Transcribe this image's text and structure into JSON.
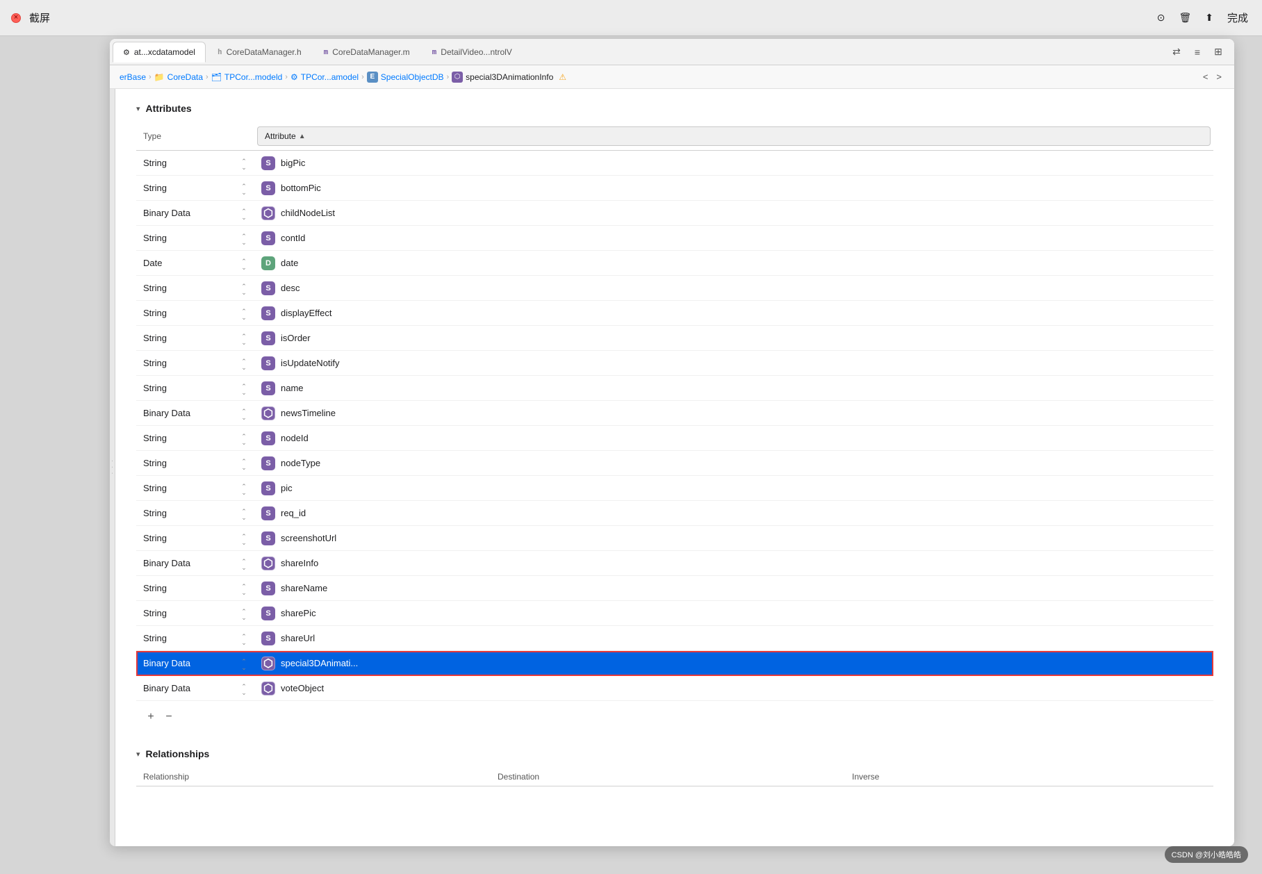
{
  "titleBar": {
    "title": "截屏",
    "closeLabel": "×",
    "actions": {
      "person": "⊙",
      "trash": "🗑",
      "share": "⬆",
      "done": "完成"
    }
  },
  "tabs": [
    {
      "id": "xcdatamodel",
      "label": "at...xcdatamodel",
      "icon": "",
      "active": true
    },
    {
      "id": "coredatamanager-h",
      "label": "CoreDataManager.h",
      "icon": "h",
      "active": false
    },
    {
      "id": "coredatamanager-m",
      "label": "CoreDataManager.m",
      "icon": "m",
      "active": false
    },
    {
      "id": "detailvideo-m",
      "label": "DetailVideo...ntrolV",
      "icon": "m",
      "active": false
    }
  ],
  "tabBarActions": {
    "swap": "⇄",
    "lines": "≡",
    "plus": "⊞"
  },
  "breadcrumb": {
    "items": [
      {
        "label": "erBase",
        "icon": "",
        "type": "folder"
      },
      {
        "label": "CoreData",
        "icon": "📁",
        "type": "folder"
      },
      {
        "label": "TPCor...modeld",
        "icon": "🗂",
        "type": "group"
      },
      {
        "label": "TPCor...amodel",
        "icon": "⚙",
        "type": "model"
      },
      {
        "label": "SpecialObjectDB",
        "icon": "E",
        "type": "entity"
      },
      {
        "label": "special3DAnimationInfo",
        "icon": "⬡",
        "type": "attribute"
      }
    ],
    "warning": "⚠",
    "navBack": "<",
    "navForward": ">"
  },
  "sections": {
    "attributes": {
      "title": "Attributes",
      "collapsed": false,
      "tableHeaders": {
        "type": "Type",
        "attribute": "Attribute",
        "sortAsc": true
      },
      "rows": [
        {
          "type": "String",
          "badge": "S",
          "badgeType": "s",
          "name": "bigPic"
        },
        {
          "type": "String",
          "badge": "S",
          "badgeType": "s",
          "name": "bottomPic"
        },
        {
          "type": "Binary Data",
          "badge": "⬡",
          "badgeType": "binary",
          "name": "childNodeList"
        },
        {
          "type": "String",
          "badge": "S",
          "badgeType": "s",
          "name": "contId"
        },
        {
          "type": "Date",
          "badge": "D",
          "badgeType": "d",
          "name": "date"
        },
        {
          "type": "String",
          "badge": "S",
          "badgeType": "s",
          "name": "desc"
        },
        {
          "type": "String",
          "badge": "S",
          "badgeType": "s",
          "name": "displayEffect"
        },
        {
          "type": "String",
          "badge": "S",
          "badgeType": "s",
          "name": "isOrder"
        },
        {
          "type": "String",
          "badge": "S",
          "badgeType": "s",
          "name": "isUpdateNotify"
        },
        {
          "type": "String",
          "badge": "S",
          "badgeType": "s",
          "name": "name"
        },
        {
          "type": "Binary Data",
          "badge": "⬡",
          "badgeType": "binary",
          "name": "newsTimeline"
        },
        {
          "type": "String",
          "badge": "S",
          "badgeType": "s",
          "name": "nodeId"
        },
        {
          "type": "String",
          "badge": "S",
          "badgeType": "s",
          "name": "nodeType"
        },
        {
          "type": "String",
          "badge": "S",
          "badgeType": "s",
          "name": "pic"
        },
        {
          "type": "String",
          "badge": "S",
          "badgeType": "s",
          "name": "req_id"
        },
        {
          "type": "String",
          "badge": "S",
          "badgeType": "s",
          "name": "screenshotUrl"
        },
        {
          "type": "Binary Data",
          "badge": "⬡",
          "badgeType": "binary",
          "name": "shareInfo"
        },
        {
          "type": "String",
          "badge": "S",
          "badgeType": "s",
          "name": "shareName"
        },
        {
          "type": "String",
          "badge": "S",
          "badgeType": "s",
          "name": "sharePic"
        },
        {
          "type": "String",
          "badge": "S",
          "badgeType": "s",
          "name": "shareUrl"
        },
        {
          "type": "Binary Data",
          "badge": "⬡",
          "badgeType": "binary",
          "name": "special3DAnimati...",
          "selected": true
        },
        {
          "type": "Binary Data",
          "badge": "⬡",
          "badgeType": "binary",
          "name": "voteObject"
        }
      ],
      "actions": {
        "add": "+",
        "remove": "−"
      }
    },
    "relationships": {
      "title": "Relationships",
      "collapsed": false,
      "tableHeaders": {
        "relationship": "Relationship",
        "destination": "Destination",
        "inverse": "Inverse"
      }
    }
  },
  "watermark": "CSDN @刘小皓皓皓",
  "colors": {
    "accent": "#0063e1",
    "badgePurple": "#7b5ea7",
    "badgeGreen": "#5ea47b",
    "selectedRow": "#0063e1",
    "selectedBorder": "#e63939"
  }
}
